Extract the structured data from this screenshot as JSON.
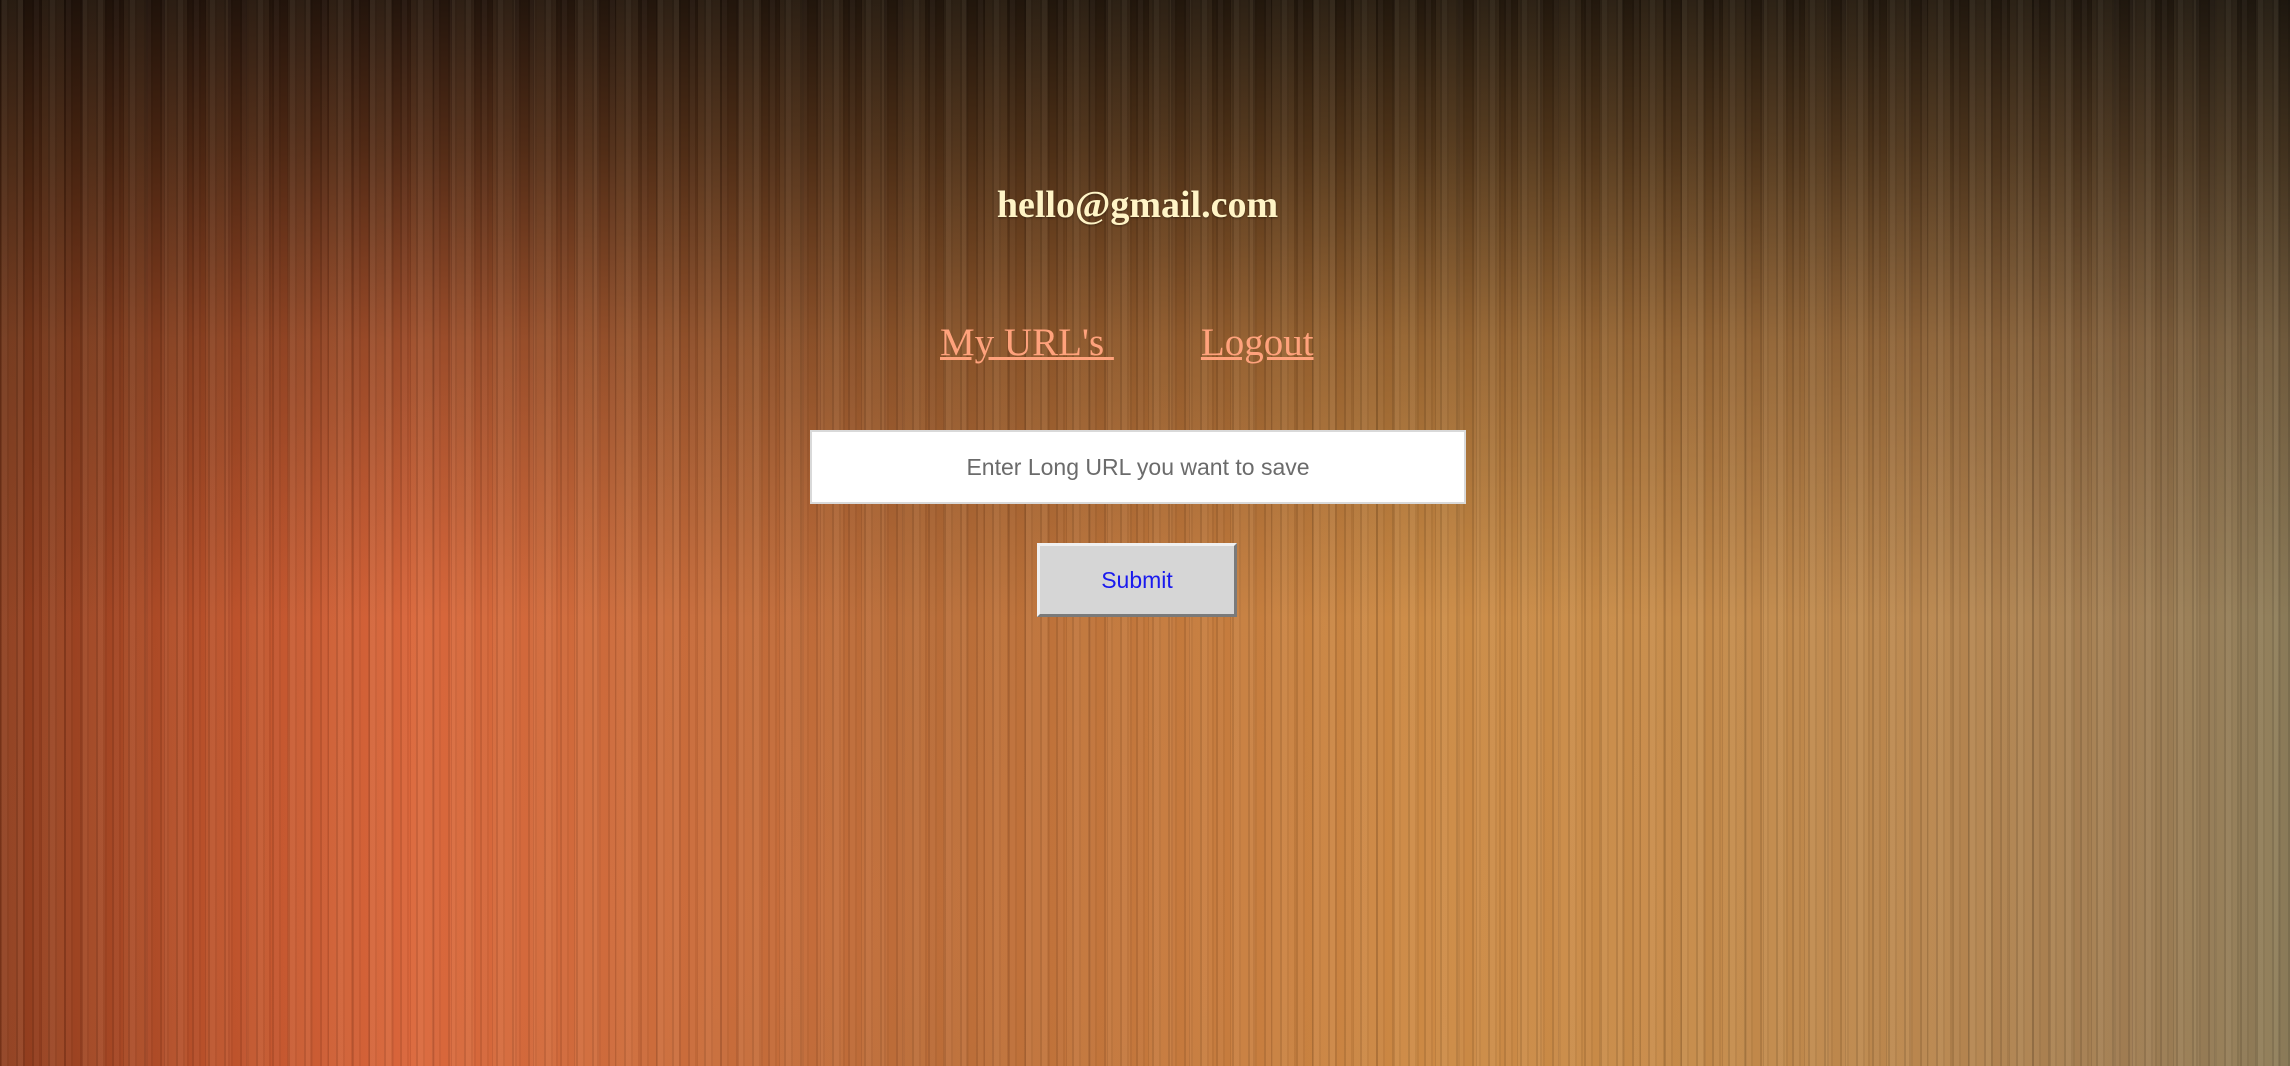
{
  "user": {
    "email": "hello@gmail.com"
  },
  "nav": {
    "my_urls_label": "My URL's ",
    "logout_label": "Logout"
  },
  "form": {
    "url_placeholder": "Enter Long URL you want to save",
    "url_value": "",
    "submit_label": "Submit"
  },
  "colors": {
    "email_text": "#fff4c6",
    "link": "#ffa27c",
    "button_text": "#1a1aee",
    "button_bg": "#d6d6d6"
  }
}
